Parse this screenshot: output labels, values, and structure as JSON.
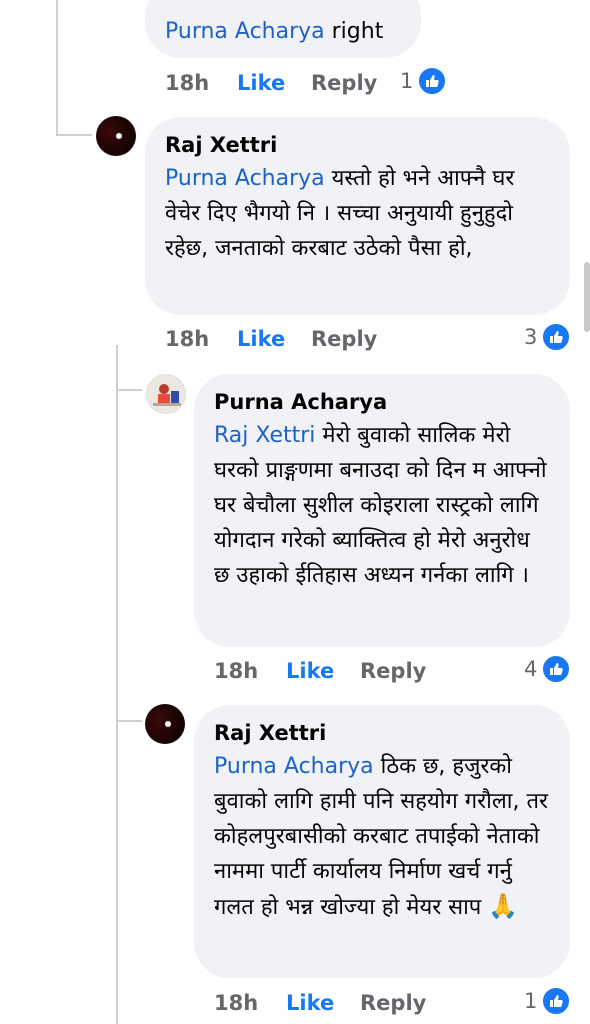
{
  "colors": {
    "accent": "#1877f2",
    "mention": "#1d62c8",
    "bubble": "#f0f2f5",
    "muted": "#65676b"
  },
  "icons": {
    "like_reaction": "thumbs-up-icon",
    "prayer_emoji": "🙏"
  },
  "comments": [
    {
      "author": "",
      "mention": "Purna Acharya",
      "text": " right",
      "time": "18h",
      "like_label": "Like",
      "reply_label": "Reply",
      "reactions": "1"
    },
    {
      "author": "Raj Xettri",
      "mention": "Purna Acharya",
      "text": " यस्तो हो भने आफ्नै घर वेचेर दिए भैगयो नि । सच्चा अनुयायी हुनुहुदो रहेछ, जनताको करबाट उठेको पैसा हो,",
      "time": "18h",
      "like_label": "Like",
      "reply_label": "Reply",
      "reactions": "3"
    },
    {
      "author": "Purna Acharya",
      "mention": "Raj Xettri",
      "text": " मेरो बुवाको सालिक मेरो घरको प्राङ्गणमा बनाउदा को दिन म आफ्नो घर बेचौला सुशील कोइराला रास्ट्रको लागि योगदान गरेको ब्याक्तित्व हो मेरो अनुरोध छ उहाको ईतिहास अध्यन गर्नका लागि ।",
      "time": "18h",
      "like_label": "Like",
      "reply_label": "Reply",
      "reactions": "4"
    },
    {
      "author": "Raj Xettri",
      "mention": "Purna Acharya",
      "text": " ठिक छ, हजुरको बुवाको लागि हामी पनि सहयोग गरौला, तर कोहलपुरबासीको करबाट तपाईको नेताको नाममा पार्टी कार्यालय निर्माण खर्च गर्नु गलत हो भन्न खोज्या हो मेयर साप ",
      "emoji": "🙏",
      "time": "18h",
      "like_label": "Like",
      "reply_label": "Reply",
      "reactions": "1"
    }
  ]
}
